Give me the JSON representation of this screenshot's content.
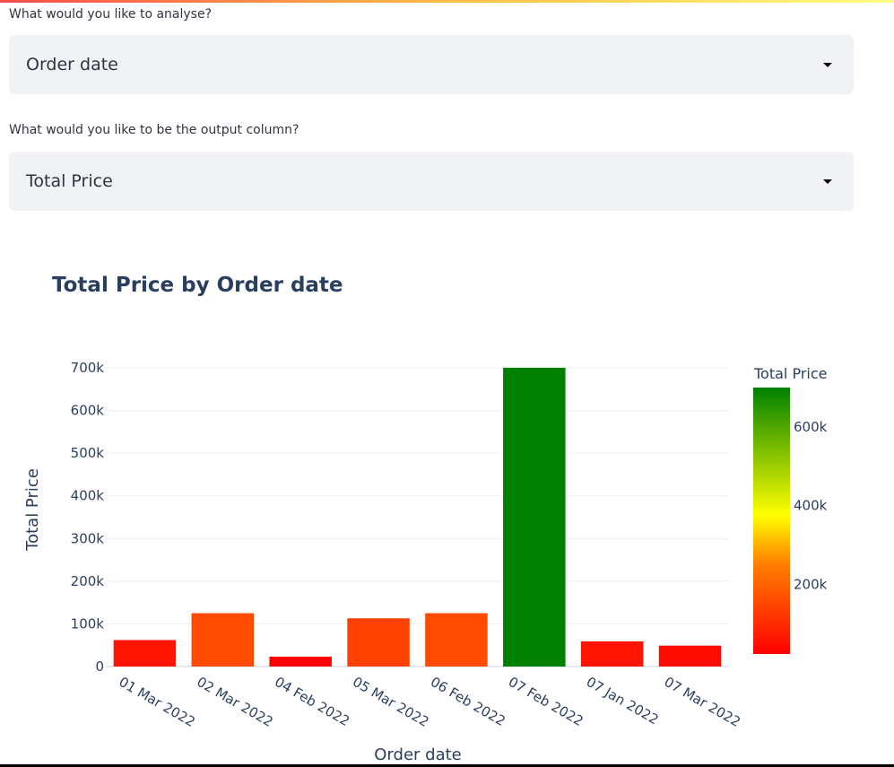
{
  "controls": {
    "analyse_label": "What would you like to analyse?",
    "analyse_value": "Order date",
    "output_label": "What would you like to be the output column?",
    "output_value": "Total Price"
  },
  "colors": {
    "title": "#2a3f5f",
    "colorscale": [
      "#ff0000",
      "#ff8000",
      "#ffff00",
      "#008000"
    ],
    "grid": "#e6e9f0"
  },
  "chart_data": {
    "type": "bar",
    "title": "Total Price by Order date",
    "xlabel": "Order date",
    "ylabel": "Total Price",
    "categories": [
      "01 Mar 2022",
      "02 Mar 2022",
      "04 Feb 2022",
      "05 Mar 2022",
      "06 Feb 2022",
      "07 Feb 2022",
      "07 Jan 2022",
      "07 Mar 2022"
    ],
    "values": [
      62000,
      125000,
      23000,
      113000,
      125000,
      700000,
      59000,
      49000
    ],
    "bar_colors": [
      "#ff1400",
      "#ff4b00",
      "#ff0000",
      "#ff4100",
      "#ff4b00",
      "#008000",
      "#ff1400",
      "#ff0c00"
    ],
    "ylim": [
      0,
      700000
    ],
    "yticks": [
      0,
      100000,
      200000,
      300000,
      400000,
      500000,
      600000,
      700000
    ],
    "ytick_labels": [
      "0",
      "100k",
      "200k",
      "300k",
      "400k",
      "500k",
      "600k",
      "700k"
    ],
    "colorbar": {
      "title": "Total Price",
      "range": [
        23000,
        700000
      ],
      "ticks": [
        200000,
        400000,
        600000
      ],
      "tick_labels": [
        "200k",
        "400k",
        "600k"
      ]
    },
    "grid": true
  }
}
